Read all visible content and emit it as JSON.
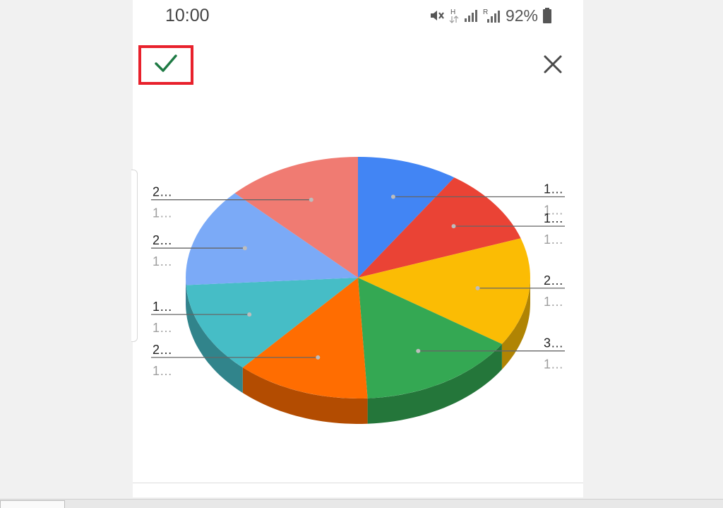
{
  "status_bar": {
    "time": "10:00",
    "battery_percent": "92%",
    "network_label_h": "H",
    "network_label_r": "R",
    "icons": [
      "mute-icon",
      "network-h-icon",
      "signal-icon",
      "signal-roaming-icon",
      "battery-icon"
    ]
  },
  "toolbar": {
    "confirm_icon": "checkmark-icon",
    "close_icon": "close-icon",
    "confirm_highlight_color": "#e8212c",
    "confirm_icon_color": "#1e7a44"
  },
  "chart_data": {
    "type": "pie",
    "style": "3d",
    "start_angle_deg": 0,
    "slices": [
      {
        "label": "1…",
        "pct_label": "1…",
        "share": 0.0944,
        "color": "#4285f4",
        "label_side": "right"
      },
      {
        "label": "1…",
        "pct_label": "1…",
        "share": 0.1027,
        "color": "#ea4335",
        "label_side": "right"
      },
      {
        "label": "2…",
        "pct_label": "1…",
        "share": 0.1454,
        "color": "#fbbc04",
        "label_side": "right"
      },
      {
        "label": "3…",
        "pct_label": "1…",
        "share": 0.1486,
        "color": "#34a853",
        "label_side": "right"
      },
      {
        "label": "2…",
        "pct_label": "1…",
        "share": 0.1255,
        "color": "#ff6d01",
        "label_side": "left"
      },
      {
        "label": "1…",
        "pct_label": "1…",
        "share": 0.1236,
        "color": "#46bdc6",
        "label_side": "left"
      },
      {
        "label": "2…",
        "pct_label": "1…",
        "share": 0.1331,
        "color": "#7baaf7",
        "label_side": "left"
      },
      {
        "label": "2…",
        "pct_label": "1…",
        "share": 0.1267,
        "color": "#f07b72",
        "label_side": "left"
      }
    ]
  }
}
